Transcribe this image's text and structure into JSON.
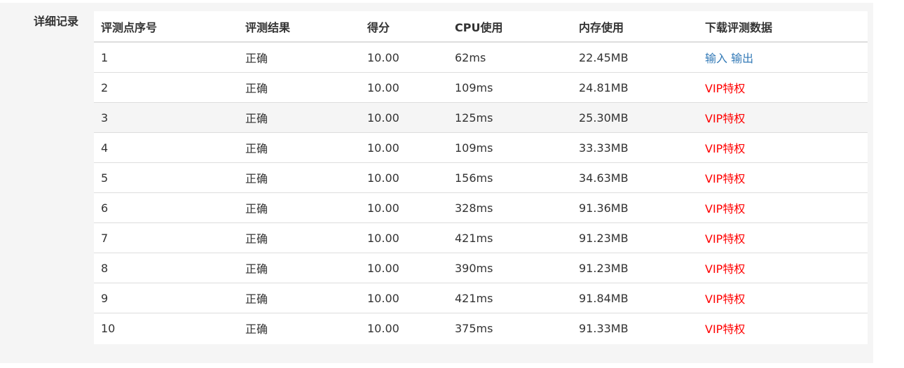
{
  "section": {
    "label": "详细记录"
  },
  "table": {
    "headers": [
      "评测点序号",
      "评测结果",
      "得分",
      "CPU使用",
      "内存使用",
      "下载评测数据"
    ],
    "rows": [
      {
        "index": "1",
        "result": "正确",
        "score": "10.00",
        "cpu": "62ms",
        "memory": "22.45MB",
        "download": {
          "type": "links",
          "input": "输入",
          "output": "输出"
        }
      },
      {
        "index": "2",
        "result": "正确",
        "score": "10.00",
        "cpu": "109ms",
        "memory": "24.81MB",
        "download": {
          "type": "vip",
          "text": "VIP特权"
        }
      },
      {
        "index": "3",
        "result": "正确",
        "score": "10.00",
        "cpu": "125ms",
        "memory": "25.30MB",
        "download": {
          "type": "vip",
          "text": "VIP特权"
        }
      },
      {
        "index": "4",
        "result": "正确",
        "score": "10.00",
        "cpu": "109ms",
        "memory": "33.33MB",
        "download": {
          "type": "vip",
          "text": "VIP特权"
        }
      },
      {
        "index": "5",
        "result": "正确",
        "score": "10.00",
        "cpu": "156ms",
        "memory": "34.63MB",
        "download": {
          "type": "vip",
          "text": "VIP特权"
        }
      },
      {
        "index": "6",
        "result": "正确",
        "score": "10.00",
        "cpu": "328ms",
        "memory": "91.36MB",
        "download": {
          "type": "vip",
          "text": "VIP特权"
        }
      },
      {
        "index": "7",
        "result": "正确",
        "score": "10.00",
        "cpu": "421ms",
        "memory": "91.23MB",
        "download": {
          "type": "vip",
          "text": "VIP特权"
        }
      },
      {
        "index": "8",
        "result": "正确",
        "score": "10.00",
        "cpu": "390ms",
        "memory": "91.23MB",
        "download": {
          "type": "vip",
          "text": "VIP特权"
        }
      },
      {
        "index": "9",
        "result": "正确",
        "score": "10.00",
        "cpu": "421ms",
        "memory": "91.84MB",
        "download": {
          "type": "vip",
          "text": "VIP特权"
        }
      },
      {
        "index": "10",
        "result": "正确",
        "score": "10.00",
        "cpu": "375ms",
        "memory": "91.33MB",
        "download": {
          "type": "vip",
          "text": "VIP特权"
        }
      }
    ],
    "hover_row": 2
  },
  "colors": {
    "link": "#337ab7",
    "vip": "#ff0000",
    "text": "#333333",
    "panel_bg": "#f5f5f5",
    "border": "#dddddd"
  }
}
